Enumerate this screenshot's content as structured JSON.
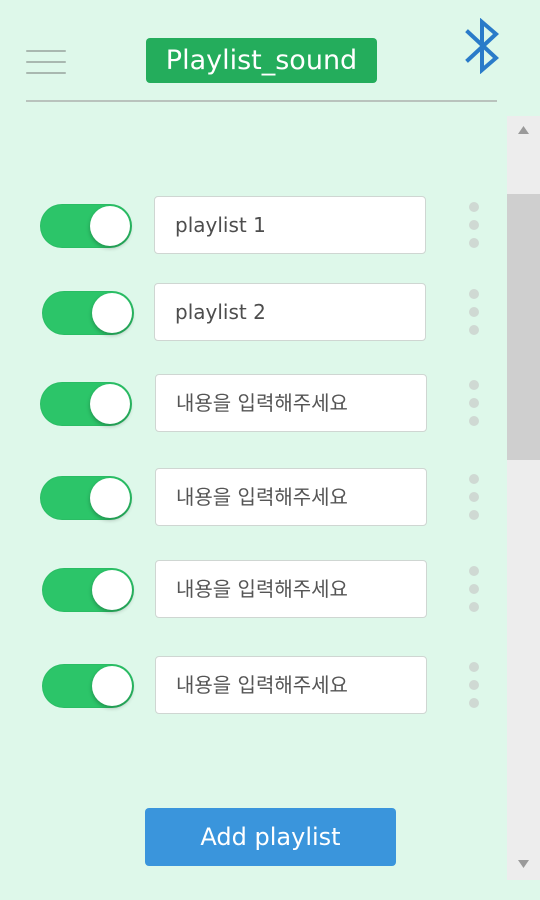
{
  "header": {
    "title": "Playlist_sound",
    "menu_icon": "hamburger-menu-icon",
    "bluetooth_icon": "bluetooth-icon",
    "title_color": "#24ad5c",
    "bluetooth_color": "#2a7bc9"
  },
  "playlists": [
    {
      "enabled": true,
      "value": "playlist 1",
      "placeholder": ""
    },
    {
      "enabled": true,
      "value": "playlist 2",
      "placeholder": ""
    },
    {
      "enabled": true,
      "value": "",
      "placeholder": "내용을 입력해주세요"
    },
    {
      "enabled": true,
      "value": "",
      "placeholder": "내용을 입력해주세요"
    },
    {
      "enabled": true,
      "value": "",
      "placeholder": "내용을 입력해주세요"
    },
    {
      "enabled": true,
      "value": "",
      "placeholder": "내용을 입력해주세요"
    }
  ],
  "add_button": {
    "label": "Add playlist",
    "color": "#3a95dc"
  },
  "colors": {
    "background": "#def8ea",
    "toggle_on": "#2cc569"
  }
}
